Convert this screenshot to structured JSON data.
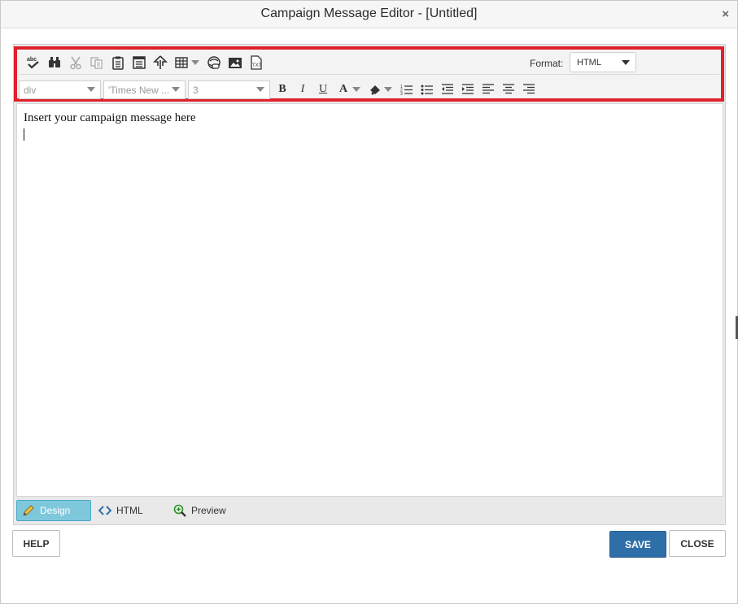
{
  "window": {
    "title": "Campaign Message Editor - [Untitled]",
    "close_glyph": "×"
  },
  "toolbar": {
    "row1_icons": [
      "spellcheck-icon",
      "find-icon",
      "cut-icon",
      "copy-icon",
      "paste-icon",
      "template-icon",
      "paragraph-direction-icon",
      "table-icon",
      "hyperlink-icon",
      "insert-image-icon",
      "text-file-icon"
    ],
    "format_label": "Format:",
    "format_value": "HTML",
    "block_format": "div",
    "font_name": "'Times New ...",
    "font_size": "3",
    "bold": "B",
    "italic": "I",
    "underline": "U",
    "font_color": "A"
  },
  "editor": {
    "content": "Insert your campaign message here"
  },
  "modes": {
    "design": "Design",
    "html": "HTML",
    "preview": "Preview"
  },
  "buttons": {
    "help": "HELP",
    "save": "SAVE",
    "close": "CLOSE"
  },
  "colors": {
    "highlight": "#e0212b",
    "save_bg": "#2f6fa9",
    "design_tab_bg": "#7fc8dc"
  }
}
